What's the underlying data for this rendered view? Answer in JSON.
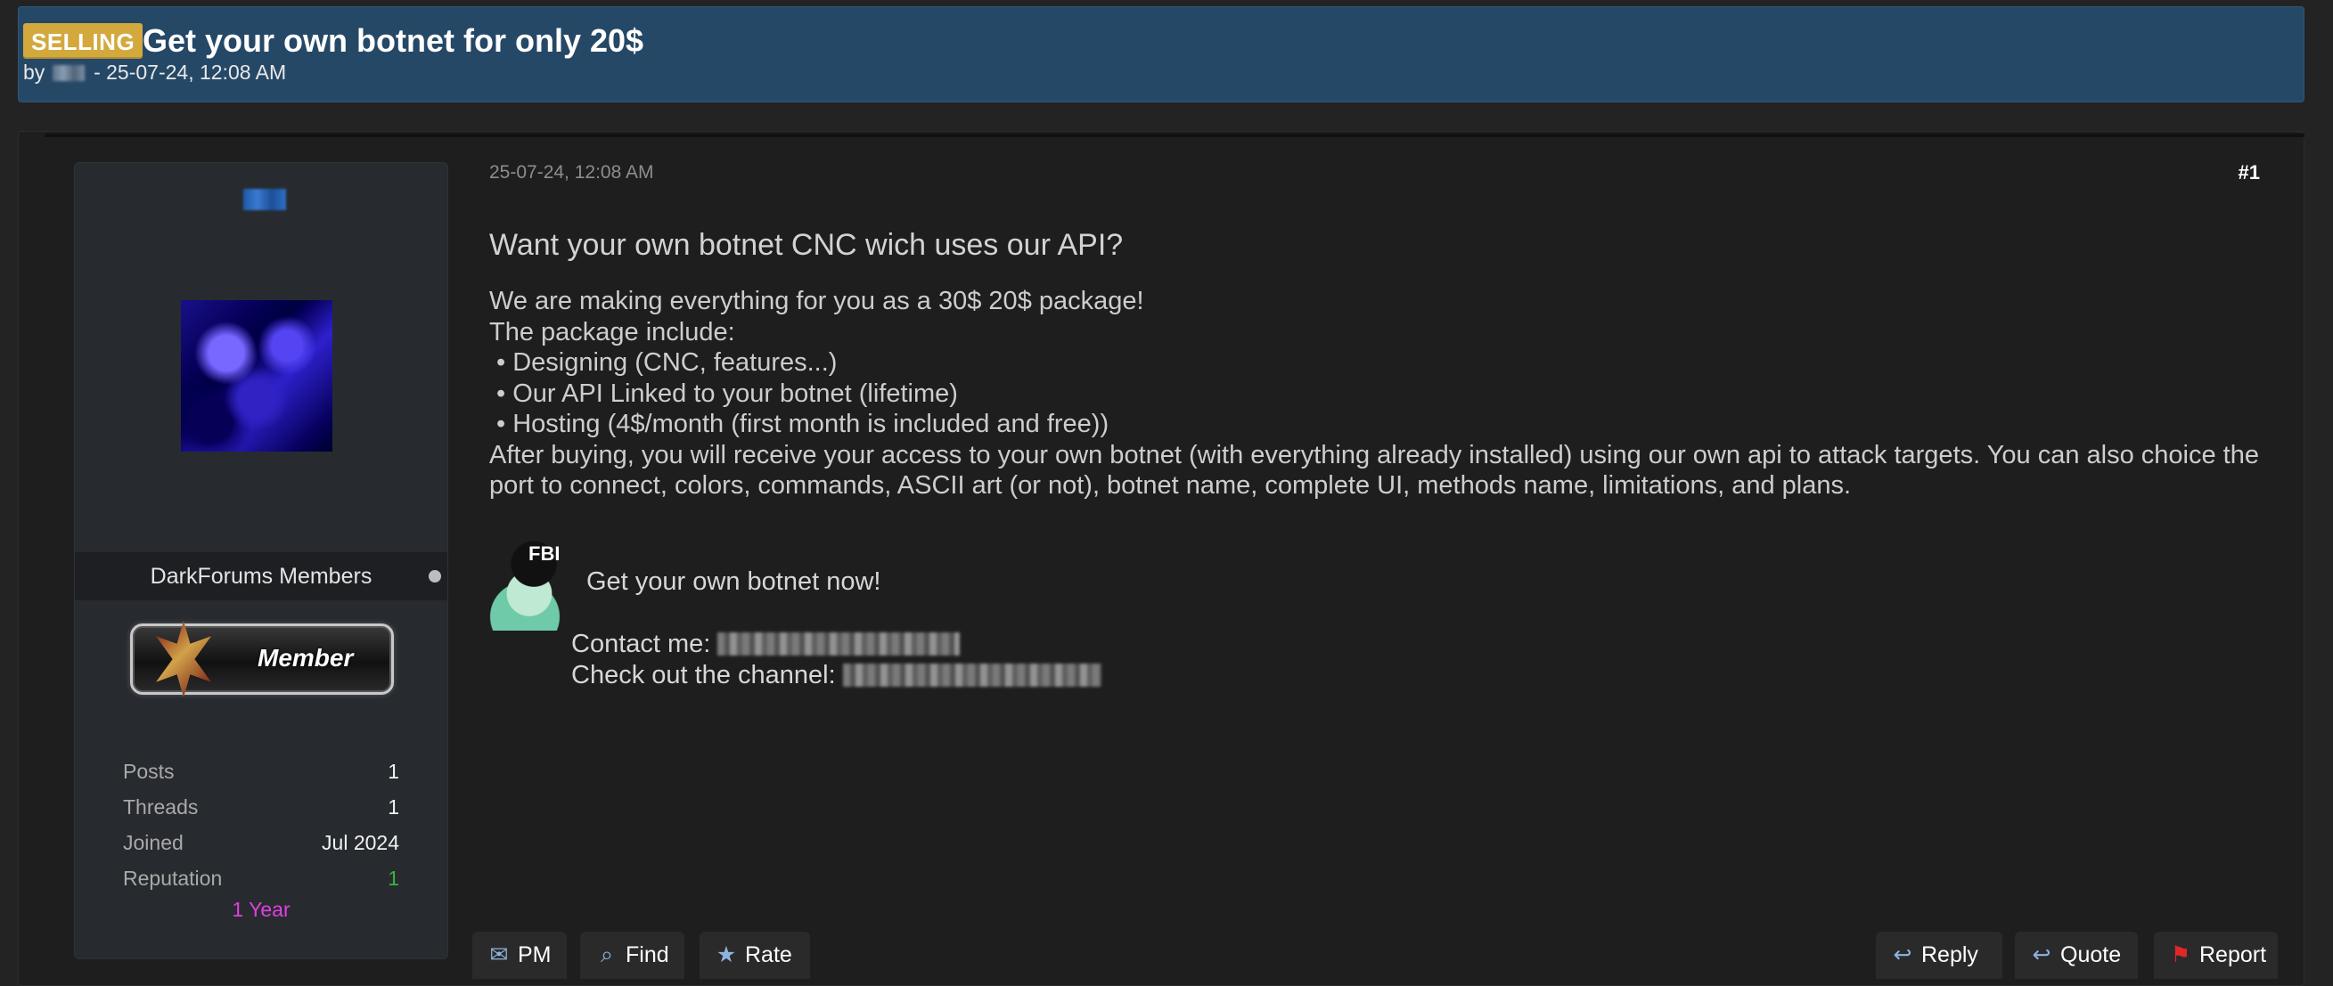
{
  "thread": {
    "tag": "SELLING",
    "title": "Get your own botnet for only 20$",
    "meta_prefix": "by",
    "meta_date": "- 25-07-24, 12:08 AM"
  },
  "author": {
    "group": "DarkForums Members",
    "rank": "Member",
    "stats": [
      {
        "label": "Posts",
        "value": "1"
      },
      {
        "label": "Threads",
        "value": "1"
      },
      {
        "label": "Joined",
        "value": "Jul 2024"
      },
      {
        "label": "Reputation",
        "value": "1"
      }
    ],
    "membership": "1 Year"
  },
  "post": {
    "date": "25-07-24, 12:08 AM",
    "number": "#1",
    "heading": "Want your own botnet CNC wich uses our API?",
    "lines": [
      "We are making everything for you as a 30$ 20$ package!",
      "The package include:",
      "• Designing (CNC, features...)",
      "• Our API Linked to your botnet (lifetime)",
      "• Hosting (4$/month (first month is included and free))",
      "After buying, you will receive your access to your own botnet (with everything already installed) using our own api to attack targets. You can also choice the port to connect, colors, commands, ASCII art (or not), botnet name, complete UI, methods name, limitations, and plans."
    ],
    "promo_text": "Get your own botnet now!",
    "promo_image_text": "FBI",
    "contact_label": "Contact me:",
    "channel_label": "Check out the channel:"
  },
  "actions": {
    "pm": "PM",
    "find": "Find",
    "rate": "Rate",
    "reply": "Reply",
    "quote": "Quote",
    "report": "Report"
  },
  "colors": {
    "header_bg": "#264867",
    "tag_bg": "#d3a93d",
    "reputation": "#3bb33b",
    "membership": "#e040e0",
    "report_icon": "#e12727"
  },
  "icons": {
    "pm": "envelope-icon",
    "find": "search-icon",
    "rate": "star-icon",
    "reply": "reply-icon",
    "quote": "quote-icon",
    "report": "flag-icon"
  }
}
